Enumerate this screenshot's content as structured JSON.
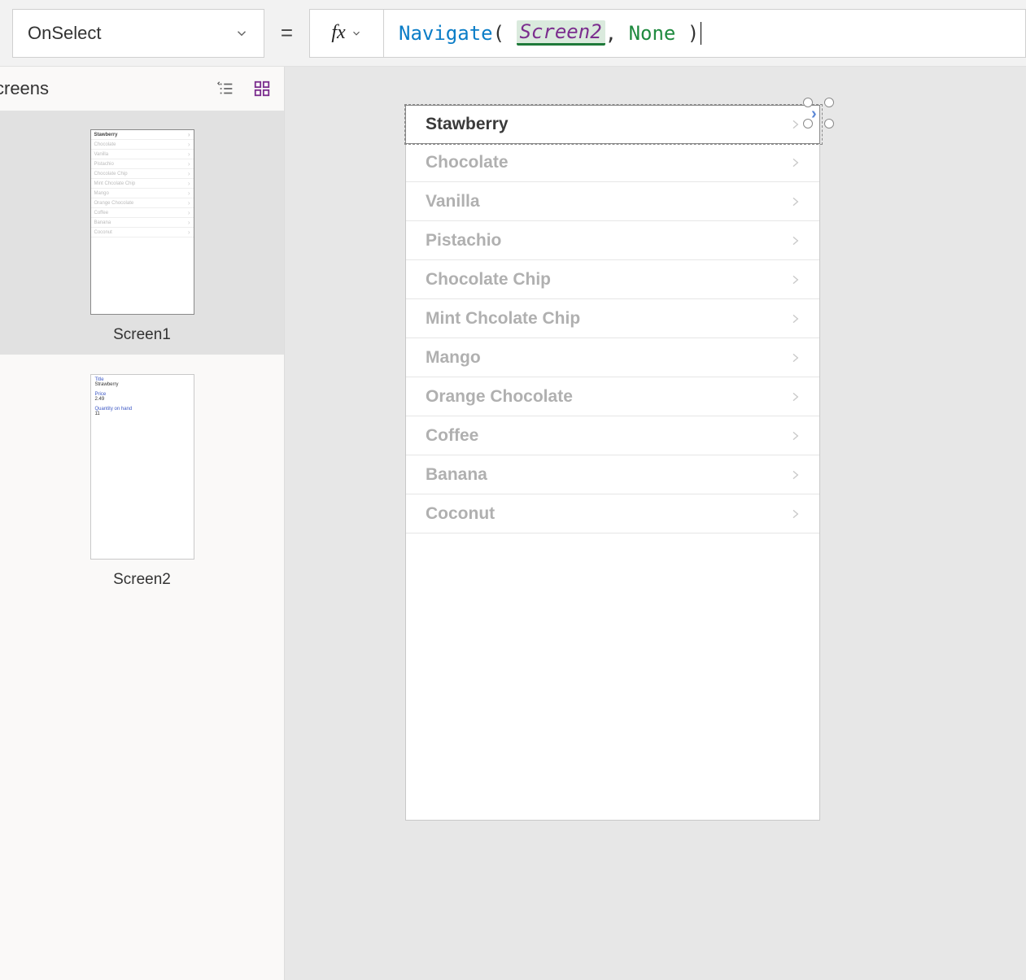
{
  "topbar": {
    "property": "OnSelect",
    "equals": "=",
    "fx": "fx",
    "formula": {
      "func": "Navigate",
      "open": "(",
      "arg1": "Screen2",
      "comma": ",",
      "arg2": "None",
      "close": ")"
    }
  },
  "leftPanel": {
    "title": "creens",
    "thumbs": [
      {
        "label": "Screen1",
        "selected": true
      },
      {
        "label": "Screen2",
        "selected": false
      }
    ],
    "screen2Detail": {
      "fields": [
        {
          "label": "Title",
          "value": "Strawberry"
        },
        {
          "label": "Price",
          "value": "2.49"
        },
        {
          "label": "Quantity on hand",
          "value": "11"
        }
      ]
    }
  },
  "gallery": {
    "items": [
      "Stawberry",
      "Chocolate",
      "Vanilla",
      "Pistachio",
      "Chocolate Chip",
      "Mint Chcolate Chip",
      "Mango",
      "Orange Chocolate",
      "Coffee",
      "Banana",
      "Coconut"
    ]
  }
}
